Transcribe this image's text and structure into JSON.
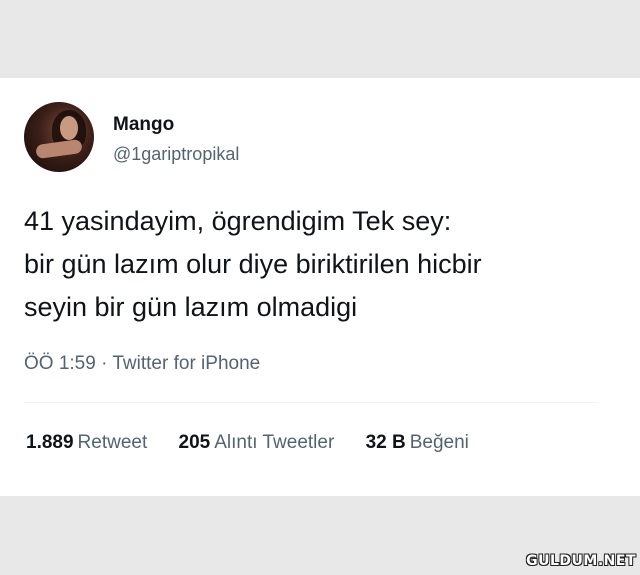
{
  "tweet": {
    "author_name": "Mango",
    "author_handle": "@1gariptropikal",
    "text_lines": [
      "41 yasindayim, ögrendigim Tek sey:",
      "bir gün lazım olur diye biriktirilen hicbir",
      "seyin bir gün lazım olmadigi"
    ],
    "time": "ÖÖ 1:59",
    "separator": "·",
    "source": "Twitter for iPhone"
  },
  "stats": [
    {
      "count": "1.889",
      "label": "Retweet"
    },
    {
      "count": "205",
      "label": "Alıntı Tweetler"
    },
    {
      "count": "32 B",
      "label": "Beğeni"
    }
  ],
  "watermark": "GULDUM.NET"
}
